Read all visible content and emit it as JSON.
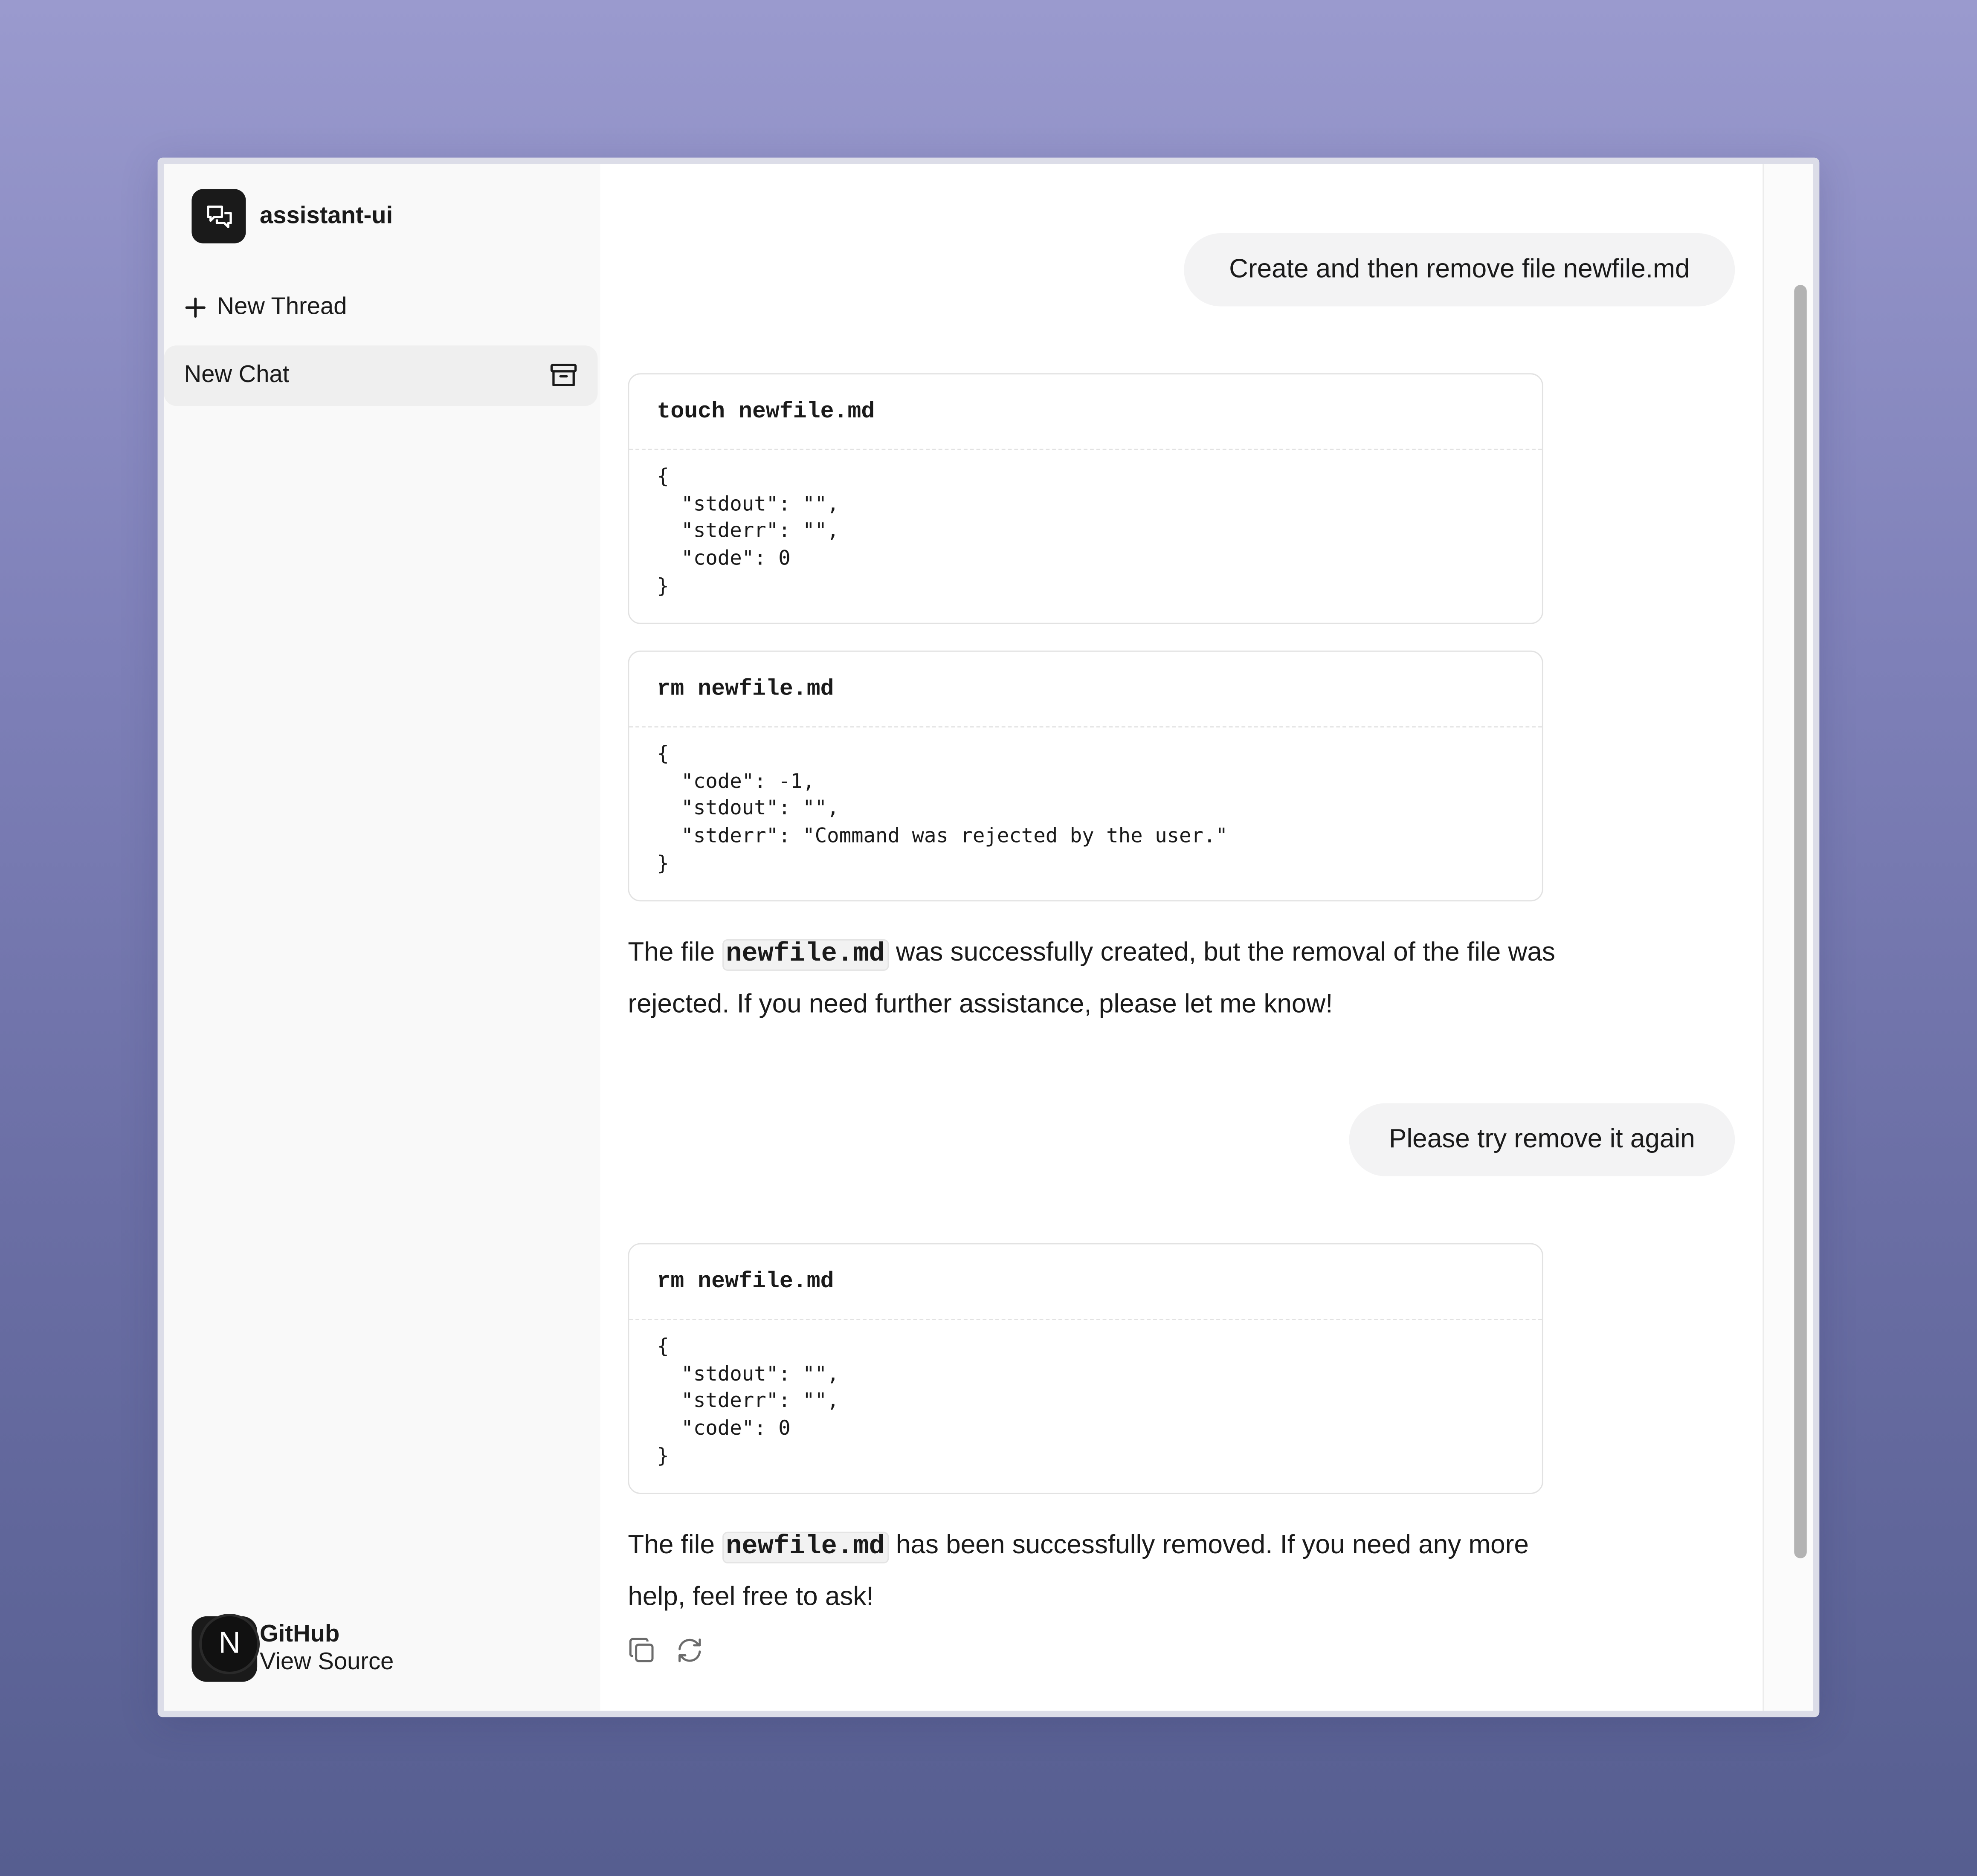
{
  "app": {
    "name": "assistant-ui"
  },
  "sidebar": {
    "new_thread_label": "New Thread",
    "threads": [
      {
        "title": "New Chat"
      }
    ],
    "footer": {
      "avatar_letter": "N",
      "title": "GitHub",
      "subtitle": "View Source"
    }
  },
  "conversation": {
    "user_message_1": "Create and then remove file newfile.md",
    "tool_call_1": {
      "command": "touch newfile.md",
      "result": "{\n  \"stdout\": \"\",\n  \"stderr\": \"\",\n  \"code\": 0\n}"
    },
    "tool_call_2": {
      "command": "rm newfile.md",
      "result": "{\n  \"code\": -1,\n  \"stdout\": \"\",\n  \"stderr\": \"Command was rejected by the user.\"\n}"
    },
    "assistant_reply_1": {
      "prefix": "The file ",
      "code": "newfile.md",
      "suffix": " was successfully created, but the removal of the file was rejected. If you need further assistance, please let me know!"
    },
    "user_message_2": "Please try remove it again",
    "tool_call_3": {
      "command": "rm newfile.md",
      "result": "{\n  \"stdout\": \"\",\n  \"stderr\": \"\",\n  \"code\": 0\n}"
    },
    "assistant_reply_2": {
      "prefix": "The file ",
      "code": "newfile.md",
      "suffix": " has been successfully removed. If you need any more help, feel free to ask!"
    }
  },
  "icons": {
    "logo": "chat-bubbles-icon",
    "new_thread": "plus-icon",
    "archive": "archive-icon",
    "copy": "copy-icon",
    "refresh": "refresh-icon"
  }
}
